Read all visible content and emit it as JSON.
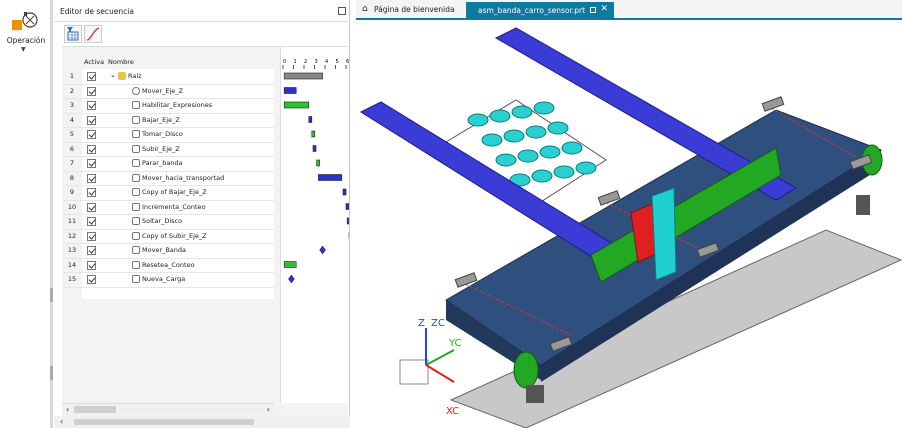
{
  "ribbon": {
    "operation_label": "Operación"
  },
  "sequence_editor": {
    "title": "Editor de secuencia",
    "columns": {
      "active": "Activa",
      "name": "Nombre"
    },
    "gantt_ticks": [
      "0",
      "1",
      "2",
      "3",
      "4",
      "5",
      "6"
    ],
    "rows": [
      {
        "num": "1",
        "name": "Raíz",
        "icon": "folder-icon"
      },
      {
        "num": "2",
        "name": "Mover_Eje_Z",
        "icon": "timer-icon"
      },
      {
        "num": "3",
        "name": "Habilitar_Expresiones",
        "icon": "link-icon"
      },
      {
        "num": "4",
        "name": "Bajar_Eje_Z",
        "icon": "link-icon"
      },
      {
        "num": "5",
        "name": "Tomar_Disco",
        "icon": "link-icon"
      },
      {
        "num": "6",
        "name": "Subir_Eje_Z",
        "icon": "link-icon"
      },
      {
        "num": "7",
        "name": "Parar_banda",
        "icon": "link-icon"
      },
      {
        "num": "8",
        "name": "Mover_hacia_transportad",
        "icon": "link-icon"
      },
      {
        "num": "9",
        "name": "Copy of Bajar_Eje_Z",
        "icon": "link-icon"
      },
      {
        "num": "10",
        "name": "Incrementa_Conteo",
        "icon": "link-icon"
      },
      {
        "num": "11",
        "name": "Soltar_Disco",
        "icon": "link-icon"
      },
      {
        "num": "12",
        "name": "Copy of Subir_Eje_Z",
        "icon": "link-icon"
      },
      {
        "num": "13",
        "name": "Mover_Banda",
        "icon": "link-icon"
      },
      {
        "num": "14",
        "name": "Resetea_Conteo",
        "icon": "link-icon"
      },
      {
        "num": "15",
        "name": "Nueva_Carga",
        "icon": "link-icon"
      }
    ]
  },
  "tabs": [
    {
      "label": "Página de bienvenida",
      "active": false
    },
    {
      "label": "asm_banda_carro_sensor.prt",
      "active": true
    }
  ],
  "triad": {
    "z_label": "Z",
    "zc_label": "ZC",
    "yc_label": "YC",
    "xc_label": "XC"
  },
  "colors": {
    "accent": "#0e7aa0",
    "belt": "#2f4f7f",
    "rail": "#3b3bd6",
    "carriage": "#22a822",
    "gripper": "#e02020",
    "sensor_post": "#20d0d0"
  }
}
